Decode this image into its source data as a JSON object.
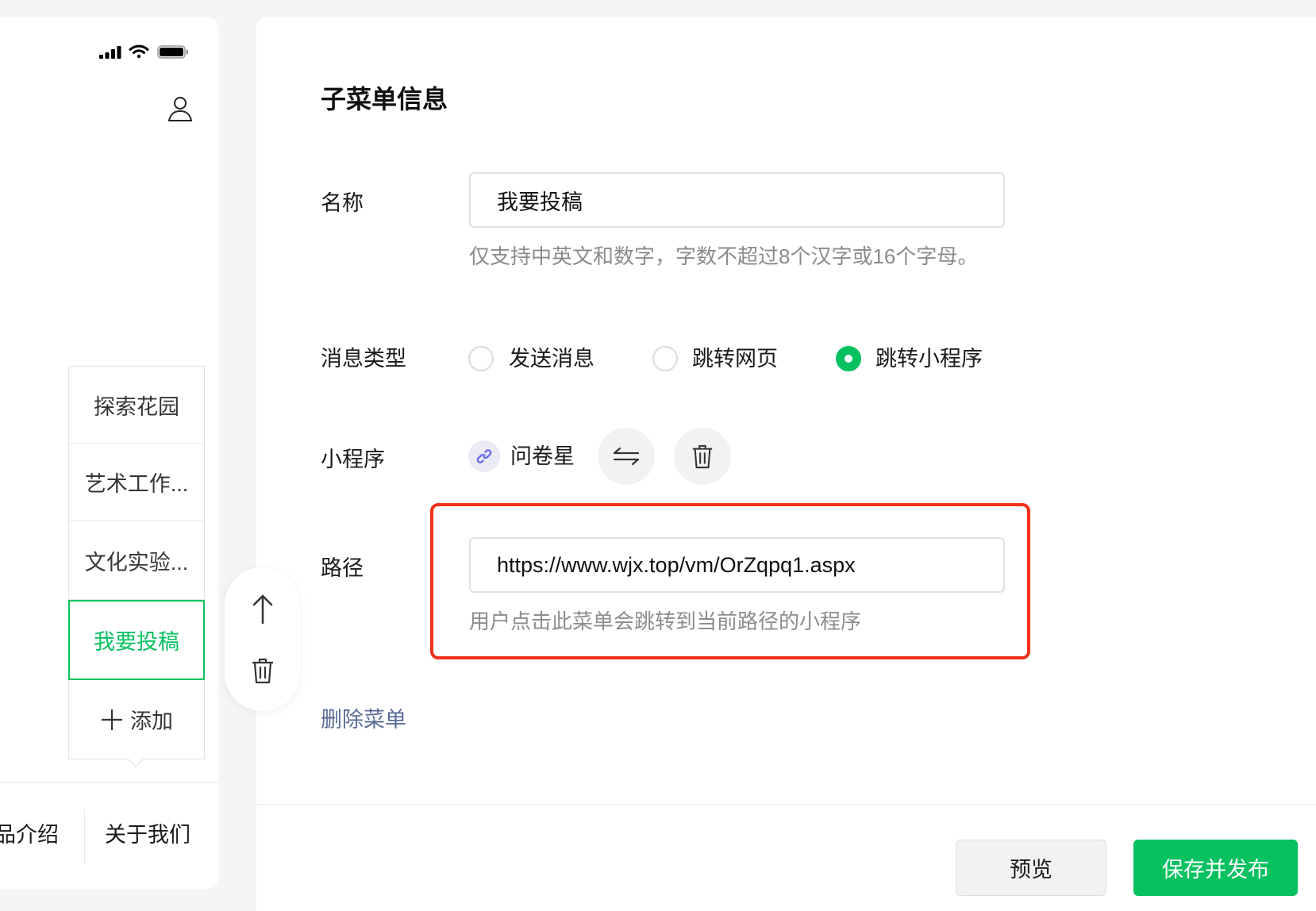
{
  "status_bar": {
    "icons": [
      "signal-icon",
      "wifi-icon",
      "battery-icon"
    ]
  },
  "phone": {
    "profile_icon": "user-icon",
    "submenu": {
      "items": [
        {
          "label": "探索花园",
          "selected": false
        },
        {
          "label": "艺术工作...",
          "selected": false
        },
        {
          "label": "文化实验...",
          "selected": false
        },
        {
          "label": "我要投稿",
          "selected": true
        }
      ],
      "add_label": "添加",
      "add_icon": "plus-icon"
    },
    "bottom_menu": [
      "品介绍",
      "关于我们"
    ]
  },
  "item_actions": {
    "icons": [
      "arrow-up-icon",
      "trash-icon"
    ]
  },
  "form": {
    "title": "子菜单信息",
    "name": {
      "label": "名称",
      "value": "我要投稿",
      "hint": "仅支持中英文和数字，字数不超过8个汉字或16个字母。"
    },
    "message_type": {
      "label": "消息类型",
      "options": [
        {
          "label": "发送消息",
          "checked": false
        },
        {
          "label": "跳转网页",
          "checked": false
        },
        {
          "label": "跳转小程序",
          "checked": true
        }
      ]
    },
    "mini_program": {
      "label": "小程序",
      "name": "问卷星",
      "icons": [
        "mini-program-link-icon",
        "swap-icon",
        "trash-icon"
      ]
    },
    "path": {
      "label": "路径",
      "value": "https://www.wjx.top/vm/OrZqpq1.aspx",
      "hint": "用户点击此菜单会跳转到当前路径的小程序"
    },
    "delete_link": "删除菜单"
  },
  "footer": {
    "preview_label": "预览",
    "publish_label": "保存并发布"
  },
  "colors": {
    "accent_green": "#07c160",
    "highlight_red": "#f0301c",
    "link_blue": "#576b95",
    "page_background": "#f4f5f7"
  }
}
